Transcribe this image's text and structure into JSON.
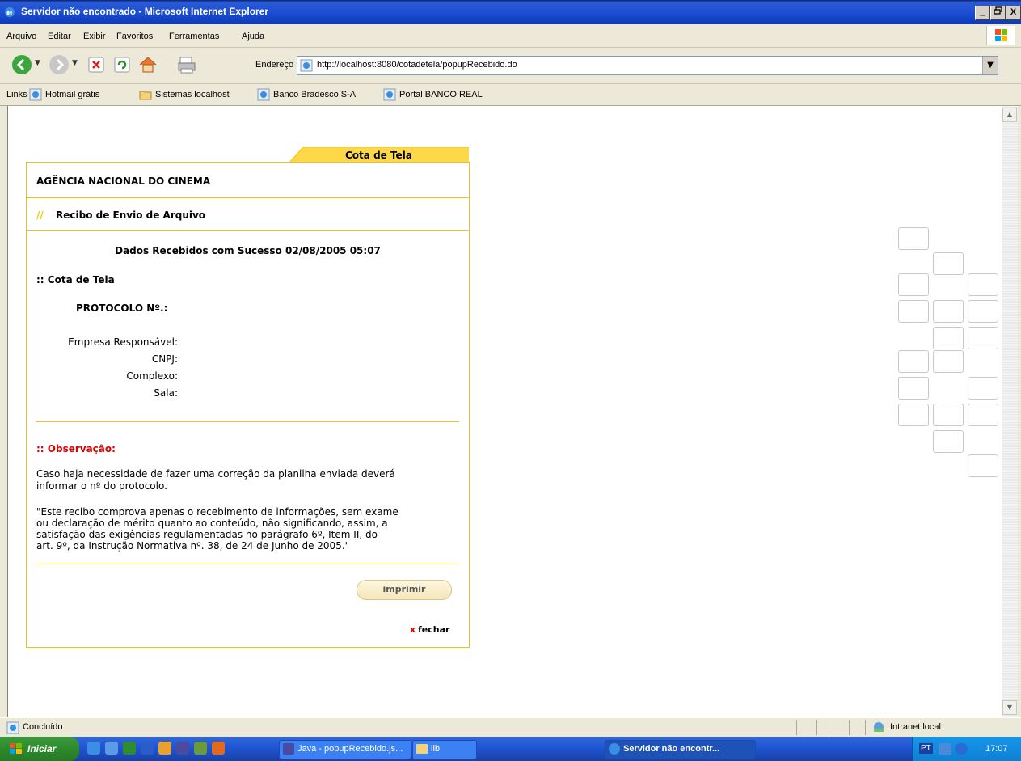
{
  "window": {
    "title": "Servidor não encontrado - Microsoft Internet Explorer",
    "btn_min": "_",
    "btn_max": "×",
    "btn_close": "X"
  },
  "menu": [
    "Arquivo",
    "Editar",
    "Exibir",
    "Favoritos",
    "Ferramentas",
    "Ajuda"
  ],
  "toolbar": {
    "address_label": "Endereço",
    "address_url": "http://localhost:8080/cotadetela/popupRecebido.do"
  },
  "links_bar": {
    "label": "Links",
    "items": [
      "Hotmail grátis",
      "Sistemas localhost",
      "Banco Bradesco S-A",
      "Portal BANCO REAL"
    ]
  },
  "receipt": {
    "tab_label": "Cota de Tela",
    "agency": "AGÊNCIA NACIONAL DO CINEMA",
    "section_slashes": "//",
    "section_title": "Recibo de Envio de Arquivo",
    "success_message": "Dados Recebidos com Sucesso 02/08/2005 05:07",
    "subsection": ":: Cota de Tela",
    "protocol_label": "PROTOCOLO Nº.:",
    "fields": [
      "Empresa Responsável:",
      "CNPJ:",
      "Complexo:",
      "Sala:"
    ],
    "observation_title": ":: Observação:",
    "observation_line1": "Caso haja necessidade de fazer uma correção da planilha enviada deverá",
    "observation_line2": "informar o nº do protocolo.",
    "disclaimer": [
      "\"Este recibo comprova apenas o recebimento de informações, sem exame",
      "ou declaração de mérito quanto ao conteúdo, não significando, assim, a",
      "satisfação das exigências regulamentadas no parágrafo 6º, Item II, do",
      "art. 9º, da Instrução Normativa nº. 38, de 24 de Junho de 2005.\""
    ],
    "print_button": "imprimir",
    "close_x": "x",
    "close_label": "fechar"
  },
  "status": {
    "text": "Concluído",
    "zone": "Intranet local"
  },
  "taskbar": {
    "start": "Iniciar",
    "tasks": [
      "Java - popupRecebido.js...",
      "lib",
      "Servidor não encontr..."
    ],
    "lang": "PT",
    "clock": "17:07"
  },
  "colors": {
    "accent_yellow": "#f2c500",
    "warning_red": "#e00000",
    "title_blue": "#0a246a"
  }
}
